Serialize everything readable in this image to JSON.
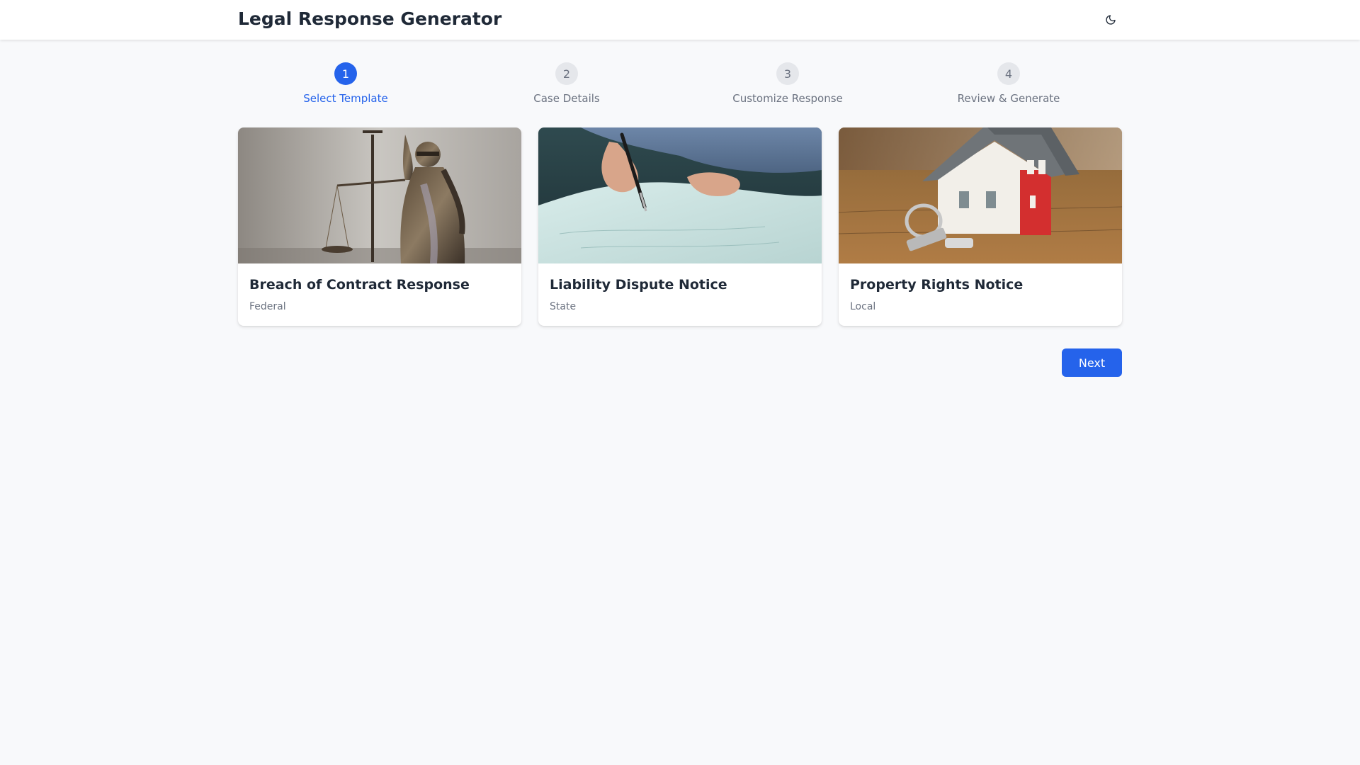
{
  "header": {
    "title": "Legal Response Generator",
    "theme_toggle_icon": "moon-icon"
  },
  "stepper": {
    "active_step": 1,
    "steps": [
      {
        "number": "1",
        "label": "Select Template"
      },
      {
        "number": "2",
        "label": "Case Details"
      },
      {
        "number": "3",
        "label": "Customize Response"
      },
      {
        "number": "4",
        "label": "Review & Generate"
      }
    ]
  },
  "templates": [
    {
      "title": "Breach of Contract Response",
      "jurisdiction": "Federal",
      "image": "lady-justice-statue"
    },
    {
      "title": "Liability Dispute Notice",
      "jurisdiction": "State",
      "image": "hand-signing-document"
    },
    {
      "title": "Property Rights Notice",
      "jurisdiction": "Local",
      "image": "house-model-with-keys"
    }
  ],
  "actions": {
    "next_label": "Next"
  },
  "colors": {
    "accent": "#2563eb",
    "background": "#f8f9fb",
    "header_bg": "#ffffff",
    "muted_text": "#6b7280",
    "inactive_step": "#e5e7eb"
  }
}
